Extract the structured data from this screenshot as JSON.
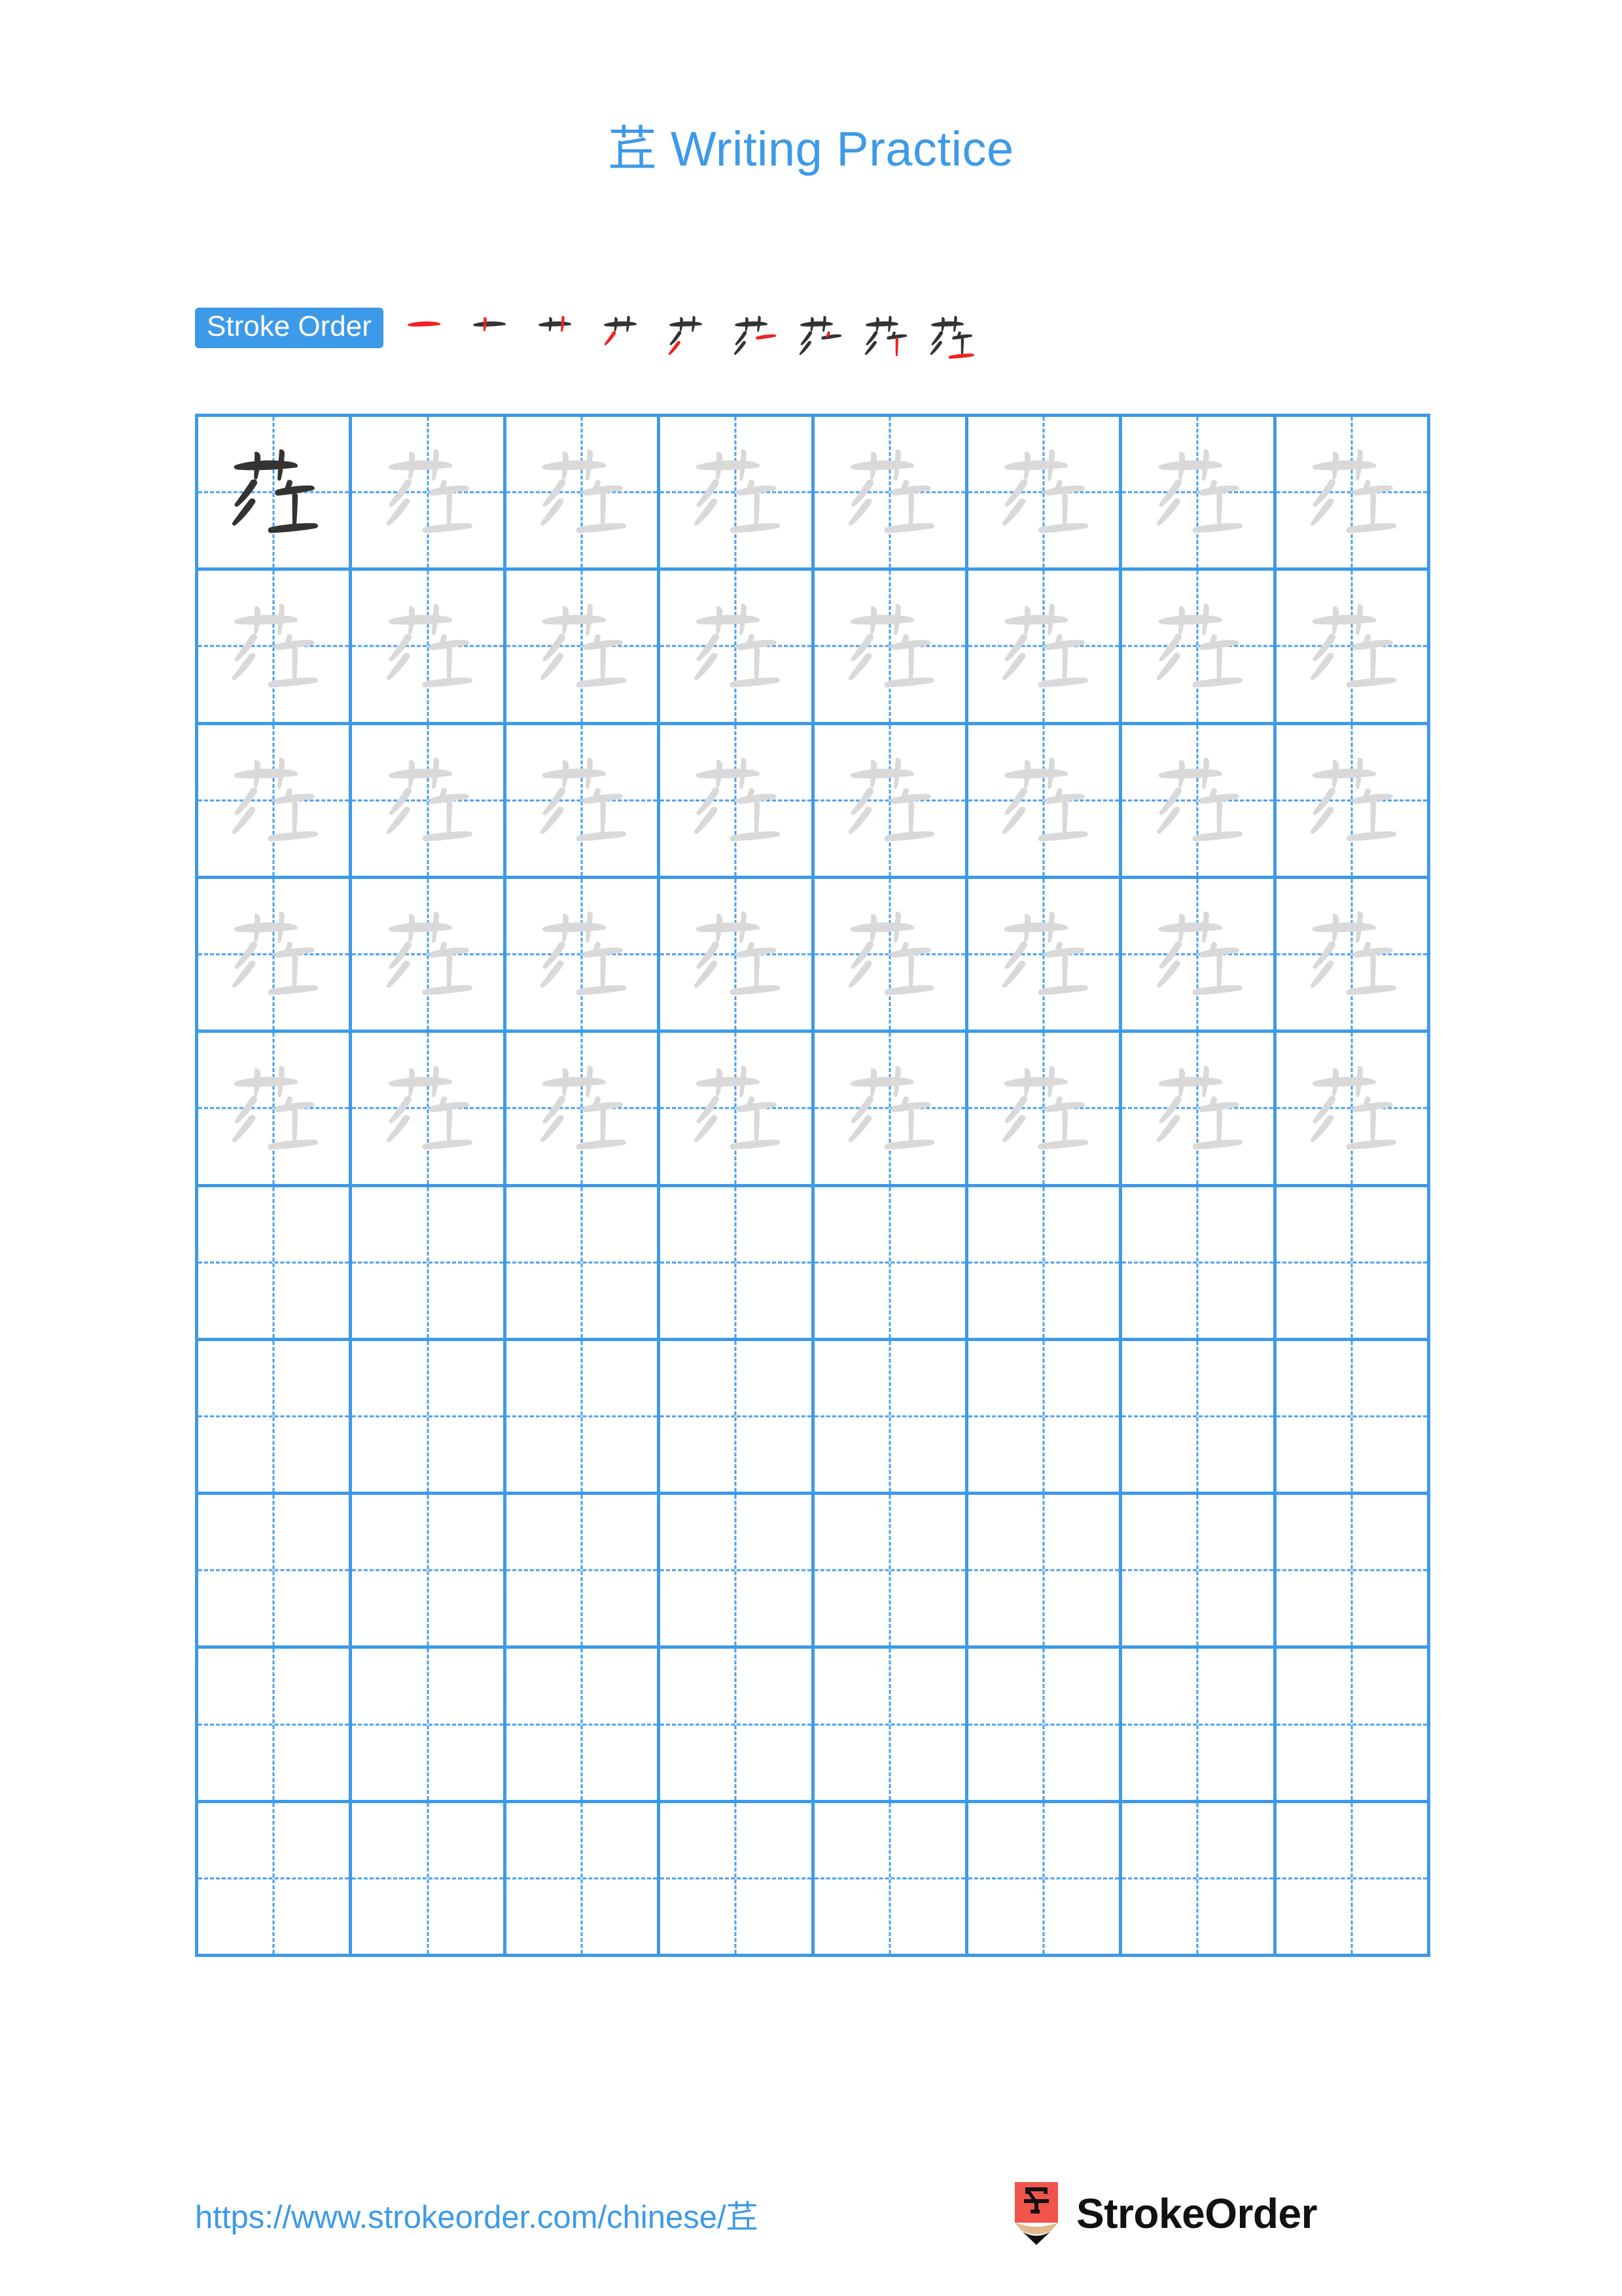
{
  "page": {
    "background_color": "#ffffff",
    "accent_color": "#3d9ae8",
    "stroke_new_color": "#ee2222",
    "stroke_done_color": "#333333",
    "trace_color": "#d9d9d9",
    "solid_color": "#333333"
  },
  "header": {
    "character": "茊",
    "title_suffix": " Writing Practice",
    "full_title": "茊 Writing Practice"
  },
  "stroke_order": {
    "badge_label": "Stroke Order",
    "total_strokes": 9,
    "steps": [
      {
        "index": 1,
        "name": "heng",
        "new_stroke": "horizontal"
      },
      {
        "index": 2,
        "name": "shu",
        "new_stroke": "vertical-left"
      },
      {
        "index": 3,
        "name": "shu",
        "new_stroke": "vertical-right"
      },
      {
        "index": 4,
        "name": "pie-zhe",
        "new_stroke": "left-slant"
      },
      {
        "index": 5,
        "name": "pie",
        "new_stroke": "lower-left-slant"
      },
      {
        "index": 6,
        "name": "heng",
        "new_stroke": "right-horizontal-top"
      },
      {
        "index": 7,
        "name": "dian",
        "new_stroke": "right-dot"
      },
      {
        "index": 8,
        "name": "shu",
        "new_stroke": "right-vertical"
      },
      {
        "index": 9,
        "name": "heng",
        "new_stroke": "bottom-horizontal"
      }
    ]
  },
  "grid": {
    "columns": 8,
    "rows": 10,
    "filled_rows": 5,
    "empty_rows": 5,
    "solid_cells": 1,
    "guide_style": "dashed-cross"
  },
  "footer": {
    "url": "https://www.strokeorder.com/chinese/茊",
    "brand_name": "StrokeOrder",
    "logo_character": "字"
  }
}
